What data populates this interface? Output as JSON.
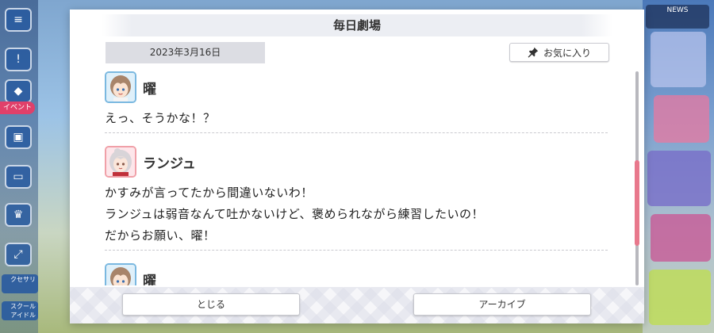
{
  "dialog": {
    "title": "毎日劇場",
    "date": "2023年3月16日",
    "favorite_label": "お気に入り",
    "entries": [
      {
        "speaker": "曜",
        "lines": [
          "えっ、そうかな！？"
        ]
      },
      {
        "speaker": "ランジュ",
        "lines": [
          "かすみが言ってたから間違いないわ！",
          "ランジュは弱音なんて吐かないけど、褒められながら練習したいの！",
          "だからお願い、曜！"
        ]
      },
      {
        "speaker": "曜",
        "lines": []
      }
    ],
    "close_label": "とじる",
    "archive_label": "アーカイブ"
  },
  "background": {
    "side_badge": "イベント",
    "side_label_1": "クセサリ",
    "side_label_2": "スクール アイドル",
    "top_right": "NEWS"
  },
  "colors": {
    "accent_pink": "#e8788c",
    "avatar_blue_border": "#7ab8e0",
    "avatar_pink_border": "#f0a0a8"
  }
}
